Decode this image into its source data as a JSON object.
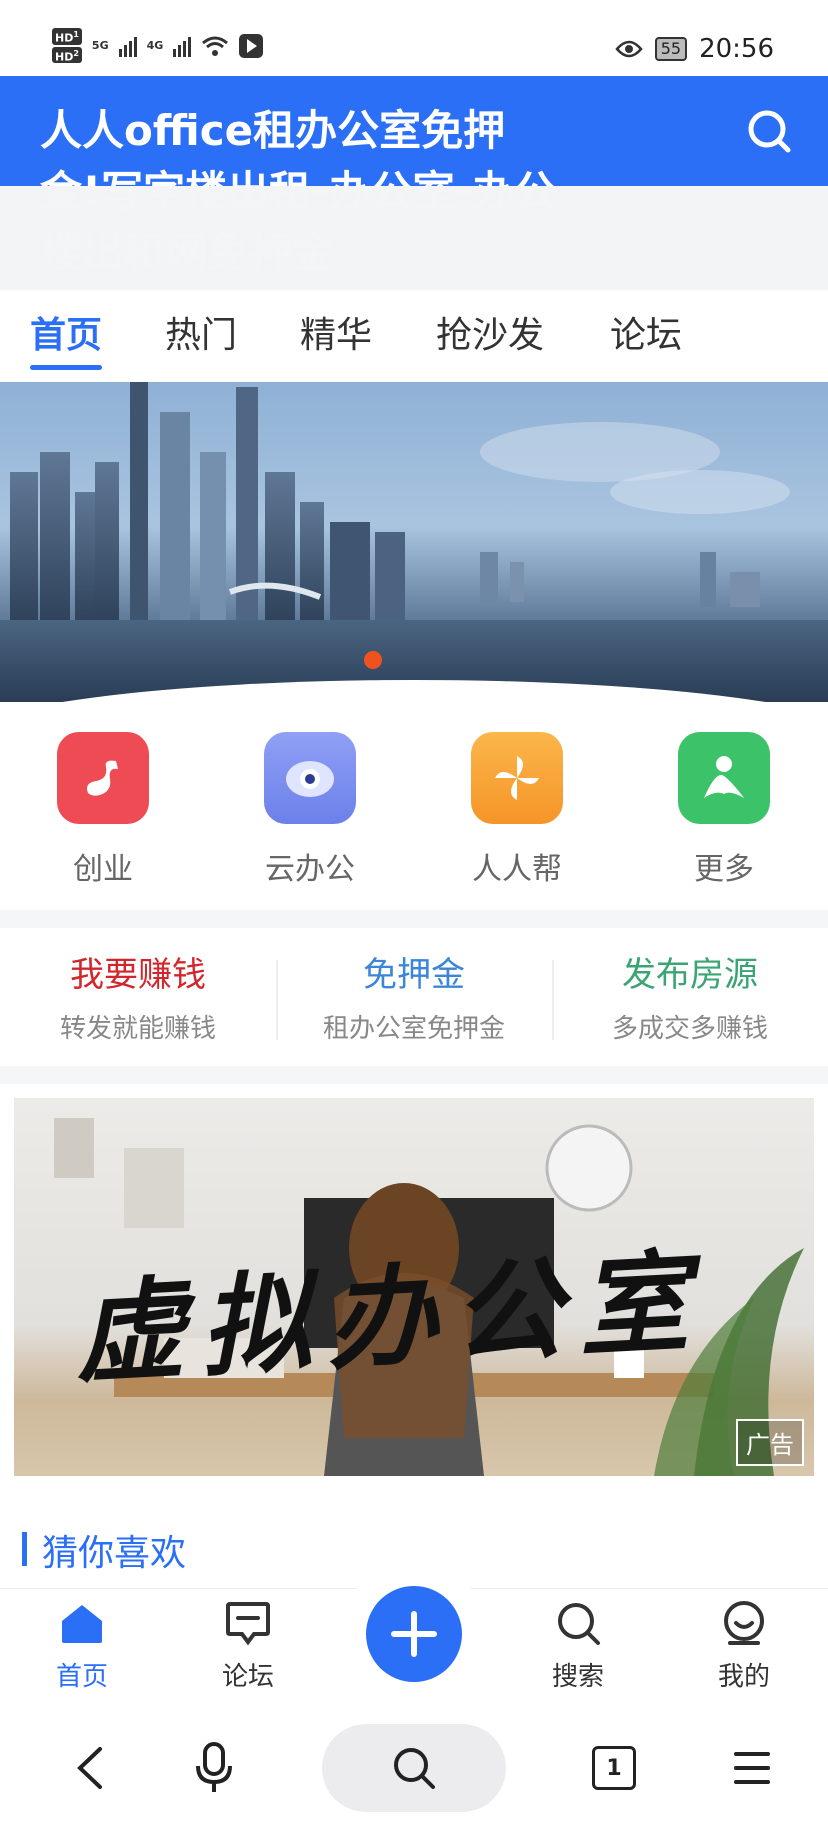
{
  "status_bar": {
    "hd1": "HD",
    "hd1_sim": "1",
    "hd2": "HD",
    "hd2_sim": "2",
    "net1": "5G",
    "net2": "4G",
    "battery": "55",
    "time": "20:56"
  },
  "header": {
    "title": "人人office租办公室免押金!写字楼出租-办公室-办公楼出租网免押金"
  },
  "tabs": [
    "首页",
    "热门",
    "精华",
    "抢沙发",
    "论坛"
  ],
  "banner": {
    "active_slide": 1
  },
  "quick_icons": [
    {
      "label": "创业",
      "icon": "music-note-icon",
      "color": "#ef4b55"
    },
    {
      "label": "云办公",
      "icon": "eye-cloud-icon",
      "color": "#7b8ef0"
    },
    {
      "label": "人人帮",
      "icon": "pinwheel-icon",
      "color": "#f7a234"
    },
    {
      "label": "更多",
      "icon": "person-icon",
      "color": "#3cc36a"
    }
  ],
  "promo": [
    {
      "title": "我要赚钱",
      "sub": "转发就能赚钱",
      "color": "#d2262c"
    },
    {
      "title": "免押金",
      "sub": "租办公室免押金",
      "color": "#3b86d8"
    },
    {
      "title": "发布房源",
      "sub": "多成交多赚钱",
      "color": "#3aa472"
    }
  ],
  "ad": {
    "text": "虚拟办公室",
    "badge": "广告"
  },
  "guess": {
    "title": "猜你喜欢"
  },
  "bottom_nav": {
    "home": "首页",
    "forum": "论坛",
    "search": "搜索",
    "mine": "我的"
  },
  "system_bar": {
    "tab_count": "1"
  }
}
